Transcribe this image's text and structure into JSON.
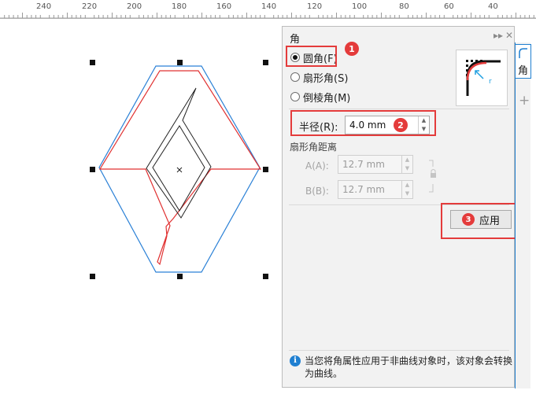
{
  "ruler": {
    "labels": [
      "240",
      "220",
      "200",
      "180",
      "160",
      "140",
      "120",
      "100",
      "80",
      "60",
      "40"
    ]
  },
  "panel": {
    "title": "角",
    "pin_icon": "pin-icon",
    "close_icon": "close-icon",
    "options": {
      "round": "圆角(F)",
      "scallop": "扇形角(S)",
      "chamfer": "倒棱角(M)"
    },
    "selected_option": "round",
    "radius_label": "半径(R):",
    "radius_value": "4.0 mm",
    "scallop_distance_heading": "扇形角距离",
    "a_label": "A(A):",
    "a_value": "12.7 mm",
    "b_label": "B(B):",
    "b_value": "12.7 mm",
    "apply_label": "应用",
    "info_text": "当您将角属性应用于非曲线对象时，该对象会转换为曲线。"
  },
  "side_tab": {
    "label": "角",
    "add_icon": "plus-icon"
  },
  "badges": {
    "b1": "1",
    "b2": "2",
    "b3": "3"
  },
  "colors": {
    "annotation_red": "#e43b3b",
    "accent_blue": "#1f7fd1",
    "shape_red": "#e03030",
    "shape_blue": "#2a80d6"
  }
}
